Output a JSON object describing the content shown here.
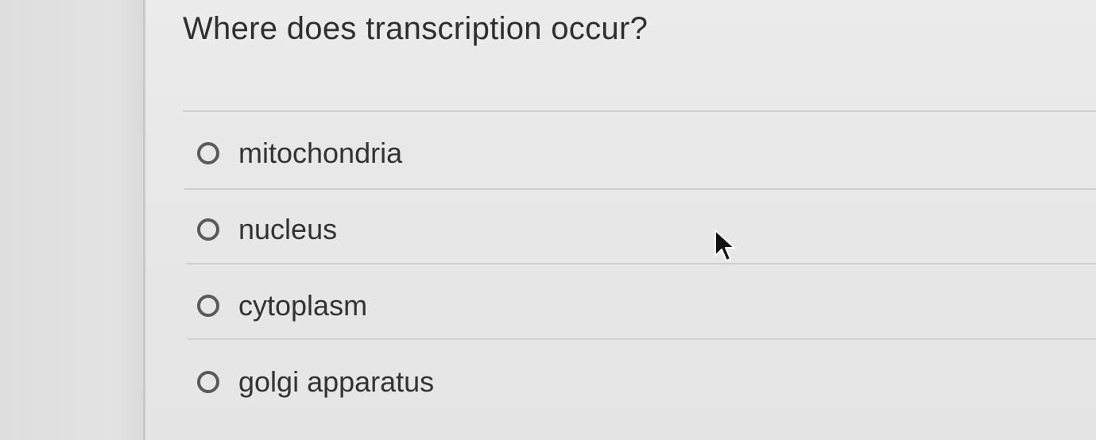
{
  "question": {
    "text": "Where does transcription occur?"
  },
  "options": [
    {
      "label": "mitochondria",
      "selected": false
    },
    {
      "label": "nucleus",
      "selected": false
    },
    {
      "label": "cytoplasm",
      "selected": false
    },
    {
      "label": "golgi apparatus",
      "selected": false
    }
  ],
  "colors": {
    "background": "#e4e4e4",
    "panel": "#e8e8e8",
    "text": "#333333",
    "radio_border": "#5a5a5a",
    "divider": "#cfcfcf"
  },
  "icons": {
    "cursor": "mouse-pointer-icon",
    "radio": "radio-button-icon"
  }
}
